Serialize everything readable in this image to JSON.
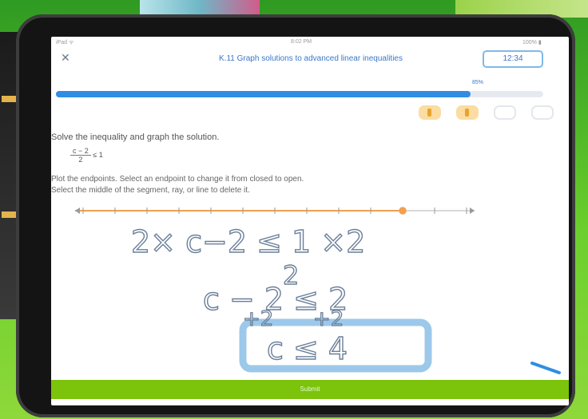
{
  "header": {
    "status_left": "iPad ᯤ",
    "status_center": "8:02 PM",
    "status_right": "100% ▮",
    "close_label": "✕",
    "title": "K.11 Graph solutions to advanced linear inequalities",
    "timer": "12:34"
  },
  "progress": {
    "label": "85%",
    "value": 0.85
  },
  "question": {
    "prompt": "Solve the inequality and graph the solution.",
    "numerator": "c − 2",
    "denominator": "2",
    "relation": "≤ 1",
    "instructions_line1": "Plot the endpoints. Select an endpoint to change it from closed to open.",
    "instructions_line2": "Select the middle of the segment, ray, or line to delete it."
  },
  "number_line": {
    "min": -6,
    "max": 6,
    "endpoint": 4,
    "endpoint_closed": true,
    "direction": "left"
  },
  "handwriting": {
    "line1": "2× c−2 ≤ 1 ×2",
    "line1_den": "2",
    "line2": "c − 2 ≤ 2",
    "line3": "+2      +2",
    "answer": "c ≤ 4"
  },
  "submit": {
    "label": "Submit"
  },
  "icons": [
    "close-icon",
    "pencil-icon",
    "battery-icon",
    "wifi-icon"
  ],
  "colors": {
    "accent": "#2f8de4",
    "submit": "#7cc30c",
    "ink": "#5a6f8a",
    "highlight": "#9cc8ea"
  }
}
